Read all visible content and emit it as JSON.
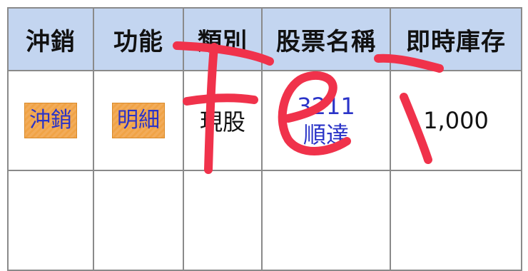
{
  "table": {
    "headers": [
      "沖銷",
      "功能",
      "類別",
      "股票名稱",
      "即時庫存"
    ],
    "rows": [
      {
        "cancel_label": "沖銷",
        "detail_label": "明細",
        "category": "現股",
        "stock_code": "3211",
        "stock_name": "順達",
        "realtime_inventory": "1,000"
      }
    ]
  },
  "colors": {
    "header_bg": "#c3d5f0",
    "button_bg": "#f0a347",
    "link": "#2a33c8",
    "annotation": "#f0324b"
  }
}
